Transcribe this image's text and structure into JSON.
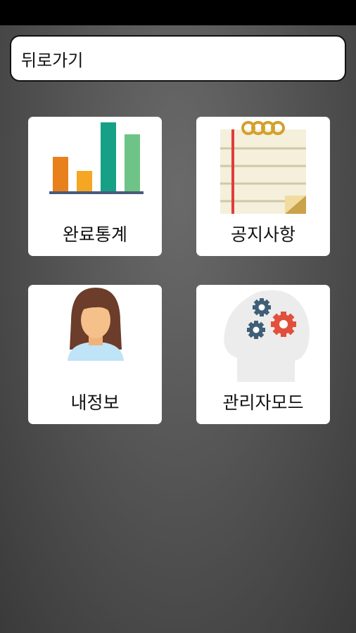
{
  "header": {
    "back_label": "뒤로가기"
  },
  "menu": {
    "items": [
      {
        "label": "완료통계",
        "icon": "bar-chart-icon"
      },
      {
        "label": "공지사항",
        "icon": "notepad-icon"
      },
      {
        "label": "내정보",
        "icon": "user-avatar-icon"
      },
      {
        "label": "관리자모드",
        "icon": "gears-head-icon"
      }
    ]
  },
  "colors": {
    "bar_orange": "#e8811c",
    "bar_yellow": "#f5a623",
    "bar_teal": "#16a085",
    "bar_green": "#6ec486",
    "gear_red": "#e0503c",
    "gear_blue": "#3f5f77"
  }
}
